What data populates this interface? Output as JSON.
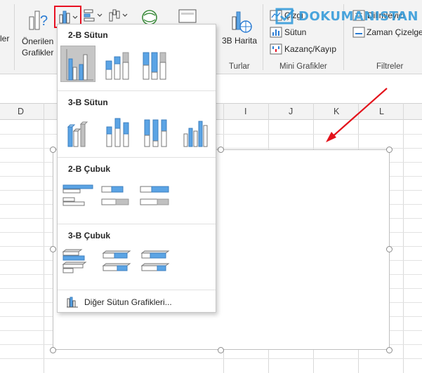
{
  "ribbon": {
    "left_cut_label": "ler",
    "recommended_line1": "Önerilen",
    "recommended_line2": "Grafikler",
    "map_label": "3B Harita",
    "tours_group": "Turlar",
    "sparklines_group": "Mini Grafikler",
    "line_label": "Çizgi",
    "column_label": "Sütun",
    "winloss_label": "Kazanç/Kayıp",
    "slicer_label": "Dilimleyici",
    "timeline_label": "Zaman Çizelge",
    "filters_group": "Filtreler"
  },
  "watermark": {
    "text": "DOKUMANISTAN"
  },
  "columns": [
    "D",
    "I",
    "J",
    "K",
    "L"
  ],
  "menu": {
    "sections": [
      {
        "title": "2-B Sütun"
      },
      {
        "title": "3-B Sütun"
      },
      {
        "title": "2-B Çubuk"
      },
      {
        "title": "3-B Çubuk"
      }
    ],
    "more_label": "Diğer Sütun Grafikleri..."
  },
  "colors": {
    "accent_blue": "#5ba4e5",
    "bar_gray": "#c0c0c0",
    "highlight_red": "#e81123",
    "arrow_red": "#e3121b"
  }
}
